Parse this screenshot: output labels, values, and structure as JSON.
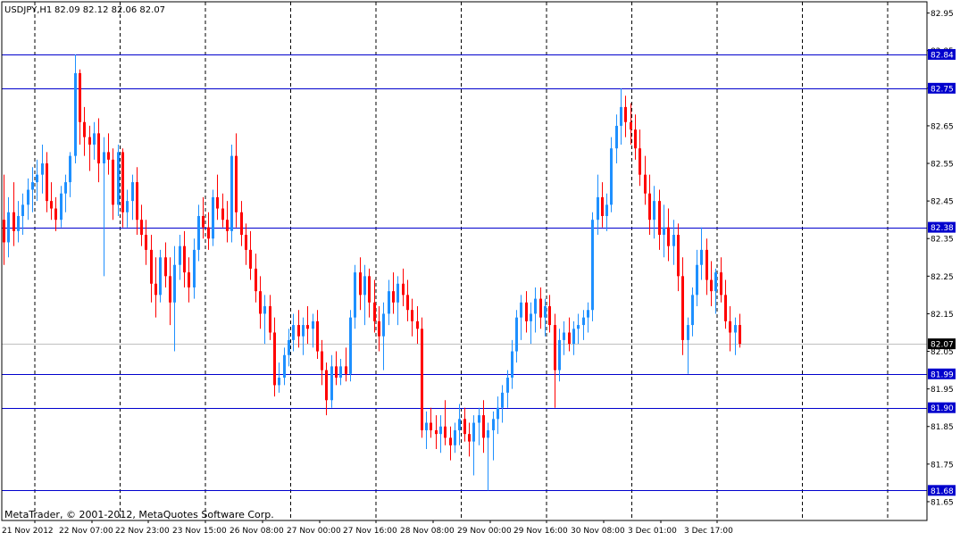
{
  "header": {
    "symbol": "USDJPY,H1",
    "ohlc": "82.09 82.12 82.06 82.07"
  },
  "footer": {
    "copyright": "MetaTrader, © 2001-2012, MetaQuotes Software Corp."
  },
  "colors": {
    "background": "#ffffff",
    "frame": "#000000",
    "bull_candle": "#1e90ff",
    "bear_candle": "#ff0000",
    "hline": "#0000cd",
    "hline_label_bg": "#0000cd",
    "hline_label_text": "#ffffff",
    "current_price_line": "#c0c0c0",
    "current_price_label_bg": "#000000",
    "current_price_label_text": "#ffffff",
    "vgrid": "#000000"
  },
  "chart_data": {
    "type": "candlestick",
    "ylim": [
      81.6,
      82.98
    ],
    "price_axis_ticks": [
      "82.95",
      "82.85",
      "82.75",
      "82.65",
      "82.55",
      "82.45",
      "82.35",
      "82.25",
      "82.15",
      "82.05",
      "81.95",
      "81.85",
      "81.75",
      "81.65"
    ],
    "time_axis_labels": [
      "21 Nov 2012",
      "22 Nov 07:00",
      "22 Nov 23:00",
      "23 Nov 15:00",
      "26 Nov 08:00",
      "27 Nov 00:00",
      "27 Nov 16:00",
      "28 Nov 08:00",
      "29 Nov 00:00",
      "29 Nov 16:00",
      "30 Nov 08:00",
      "3 Dec 01:00",
      "3 Dec 17:00"
    ],
    "vertical_separators": 15,
    "horizontal_lines": [
      {
        "label": "82.84",
        "value": 82.84
      },
      {
        "label": "82.75",
        "value": 82.75
      },
      {
        "label": "82.38",
        "value": 82.38
      },
      {
        "label": "81.99",
        "value": 81.99
      },
      {
        "label": "81.90",
        "value": 81.9
      },
      {
        "label": "81.68",
        "value": 81.68
      }
    ],
    "current_price": {
      "label": "82.07",
      "value": 82.07
    },
    "candles": [
      [
        82.4,
        82.52,
        82.28,
        82.34
      ],
      [
        82.34,
        82.46,
        82.3,
        82.42
      ],
      [
        82.42,
        82.5,
        82.33,
        82.37
      ],
      [
        82.37,
        82.45,
        82.34,
        82.41
      ],
      [
        82.41,
        82.47,
        82.36,
        82.44
      ],
      [
        82.44,
        82.51,
        82.4,
        82.48
      ],
      [
        82.48,
        82.54,
        82.42,
        82.5
      ],
      [
        82.5,
        82.56,
        82.45,
        82.52
      ],
      [
        82.52,
        82.6,
        82.47,
        82.55
      ],
      [
        82.55,
        82.58,
        82.42,
        82.45
      ],
      [
        82.45,
        82.5,
        82.4,
        82.43
      ],
      [
        82.43,
        82.46,
        82.37,
        82.4
      ],
      [
        82.4,
        82.49,
        82.38,
        82.47
      ],
      [
        82.47,
        82.52,
        82.42,
        82.5
      ],
      [
        82.5,
        82.58,
        82.46,
        82.57
      ],
      [
        82.57,
        82.84,
        82.55,
        82.79
      ],
      [
        82.79,
        82.8,
        82.6,
        82.66
      ],
      [
        82.66,
        82.7,
        82.57,
        82.62
      ],
      [
        82.62,
        82.65,
        82.53,
        82.6
      ],
      [
        82.6,
        82.66,
        82.56,
        82.63
      ],
      [
        82.63,
        82.67,
        82.5,
        82.55
      ],
      [
        82.55,
        82.62,
        82.25,
        82.58
      ],
      [
        82.58,
        82.63,
        82.52,
        82.56
      ],
      [
        82.56,
        82.59,
        82.4,
        82.44
      ],
      [
        82.44,
        82.6,
        82.41,
        82.58
      ],
      [
        82.58,
        82.59,
        82.38,
        82.42
      ],
      [
        82.42,
        82.48,
        82.38,
        82.45
      ],
      [
        82.45,
        82.52,
        82.4,
        82.5
      ],
      [
        82.5,
        82.54,
        82.36,
        82.4
      ],
      [
        82.4,
        82.44,
        82.33,
        82.36
      ],
      [
        82.36,
        82.4,
        82.28,
        82.32
      ],
      [
        82.32,
        82.36,
        82.18,
        82.23
      ],
      [
        82.23,
        82.3,
        82.14,
        82.2
      ],
      [
        82.2,
        82.32,
        82.18,
        82.3
      ],
      [
        82.3,
        82.34,
        82.22,
        82.25
      ],
      [
        82.25,
        82.3,
        82.12,
        82.18
      ],
      [
        82.18,
        82.33,
        82.05,
        82.28
      ],
      [
        82.28,
        82.36,
        82.24,
        82.33
      ],
      [
        82.33,
        82.37,
        82.22,
        82.26
      ],
      [
        82.26,
        82.3,
        82.18,
        82.22
      ],
      [
        82.22,
        82.35,
        82.19,
        82.32
      ],
      [
        82.32,
        82.44,
        82.29,
        82.41
      ],
      [
        82.41,
        82.46,
        82.35,
        82.38
      ],
      [
        82.38,
        82.42,
        82.32,
        82.35
      ],
      [
        82.35,
        82.48,
        82.33,
        82.46
      ],
      [
        82.46,
        82.52,
        82.4,
        82.43
      ],
      [
        82.43,
        82.47,
        82.38,
        82.4
      ],
      [
        82.4,
        82.45,
        82.34,
        82.37
      ],
      [
        82.37,
        82.6,
        82.34,
        82.57
      ],
      [
        82.57,
        82.63,
        82.38,
        82.42
      ],
      [
        82.42,
        82.45,
        82.33,
        82.36
      ],
      [
        82.36,
        82.39,
        82.28,
        82.32
      ],
      [
        82.32,
        82.37,
        82.24,
        82.27
      ],
      [
        82.27,
        82.31,
        82.18,
        82.21
      ],
      [
        82.21,
        82.25,
        82.11,
        82.15
      ],
      [
        82.15,
        82.2,
        82.07,
        82.17
      ],
      [
        82.17,
        82.2,
        82.08,
        82.1
      ],
      [
        82.1,
        82.14,
        81.93,
        81.96
      ],
      [
        81.96,
        82.02,
        81.94,
        81.98
      ],
      [
        81.98,
        82.06,
        81.96,
        82.04
      ],
      [
        82.04,
        82.11,
        82.01,
        82.08
      ],
      [
        82.08,
        82.15,
        82.05,
        82.12
      ],
      [
        82.12,
        82.16,
        82.06,
        82.09
      ],
      [
        82.09,
        82.14,
        82.04,
        82.12
      ],
      [
        82.12,
        82.17,
        82.07,
        82.11
      ],
      [
        82.11,
        82.15,
        82.06,
        82.13
      ],
      [
        82.13,
        82.16,
        82.03,
        82.05
      ],
      [
        82.05,
        82.08,
        81.96,
        82.0
      ],
      [
        82.0,
        82.02,
        81.88,
        81.92
      ],
      [
        81.92,
        82.04,
        81.9,
        82.01
      ],
      [
        82.01,
        82.05,
        81.96,
        81.98
      ],
      [
        81.98,
        82.03,
        81.96,
        82.01
      ],
      [
        82.01,
        82.06,
        81.97,
        81.99
      ],
      [
        81.99,
        82.16,
        81.97,
        82.14
      ],
      [
        82.14,
        82.28,
        82.11,
        82.26
      ],
      [
        82.26,
        82.3,
        82.16,
        82.2
      ],
      [
        82.2,
        82.28,
        82.12,
        82.25
      ],
      [
        82.25,
        82.27,
        82.14,
        82.18
      ],
      [
        82.18,
        82.24,
        82.1,
        82.13
      ],
      [
        82.13,
        82.17,
        82.05,
        82.09
      ],
      [
        82.09,
        82.18,
        82.0,
        82.15
      ],
      [
        82.15,
        82.24,
        82.12,
        82.21
      ],
      [
        82.21,
        82.26,
        82.15,
        82.18
      ],
      [
        82.18,
        82.25,
        82.12,
        82.23
      ],
      [
        82.23,
        82.27,
        82.17,
        82.2
      ],
      [
        82.2,
        82.24,
        82.13,
        82.16
      ],
      [
        82.16,
        82.19,
        82.09,
        82.13
      ],
      [
        82.13,
        82.17,
        82.07,
        82.11
      ],
      [
        82.11,
        82.14,
        81.82,
        81.84
      ],
      [
        81.84,
        81.89,
        81.79,
        81.86
      ],
      [
        81.86,
        81.9,
        81.82,
        81.84
      ],
      [
        81.84,
        81.88,
        81.79,
        81.83
      ],
      [
        81.83,
        81.88,
        81.78,
        81.85
      ],
      [
        81.85,
        81.92,
        81.8,
        81.82
      ],
      [
        81.82,
        81.85,
        81.76,
        81.8
      ],
      [
        81.8,
        81.86,
        81.78,
        81.84
      ],
      [
        81.84,
        81.91,
        81.8,
        81.87
      ],
      [
        81.87,
        81.9,
        81.81,
        81.83
      ],
      [
        81.83,
        81.86,
        81.77,
        81.81
      ],
      [
        81.81,
        81.88,
        81.72,
        81.86
      ],
      [
        81.86,
        81.9,
        81.8,
        81.88
      ],
      [
        81.88,
        81.92,
        81.78,
        81.82
      ],
      [
        81.82,
        81.86,
        81.68,
        81.84
      ],
      [
        81.84,
        81.89,
        81.76,
        81.87
      ],
      [
        81.87,
        81.93,
        81.83,
        81.9
      ],
      [
        81.9,
        81.96,
        81.86,
        81.94
      ],
      [
        81.94,
        82.0,
        81.9,
        81.98
      ],
      [
        81.98,
        82.08,
        81.95,
        82.05
      ],
      [
        82.05,
        82.16,
        82.02,
        82.14
      ],
      [
        82.14,
        82.2,
        82.08,
        82.18
      ],
      [
        82.18,
        82.21,
        82.1,
        82.13
      ],
      [
        82.13,
        82.18,
        82.07,
        82.15
      ],
      [
        82.15,
        82.22,
        82.1,
        82.19
      ],
      [
        82.19,
        82.22,
        82.11,
        82.14
      ],
      [
        82.14,
        82.19,
        82.09,
        82.17
      ],
      [
        82.17,
        82.2,
        82.1,
        82.12
      ],
      [
        82.12,
        82.15,
        81.9,
        82.0
      ],
      [
        82.0,
        82.11,
        81.97,
        82.08
      ],
      [
        82.08,
        82.13,
        82.04,
        82.1
      ],
      [
        82.1,
        82.14,
        82.05,
        82.07
      ],
      [
        82.07,
        82.13,
        82.04,
        82.11
      ],
      [
        82.11,
        82.15,
        82.07,
        82.12
      ],
      [
        82.12,
        82.16,
        82.08,
        82.14
      ],
      [
        82.14,
        82.18,
        82.1,
        82.16
      ],
      [
        82.16,
        82.42,
        82.13,
        82.4
      ],
      [
        82.4,
        82.52,
        82.36,
        82.46
      ],
      [
        82.46,
        82.5,
        82.38,
        82.41
      ],
      [
        82.41,
        82.47,
        82.37,
        82.44
      ],
      [
        82.44,
        82.62,
        82.42,
        82.59
      ],
      [
        82.59,
        82.68,
        82.55,
        82.65
      ],
      [
        82.65,
        82.75,
        82.6,
        82.7
      ],
      [
        82.7,
        82.73,
        82.62,
        82.66
      ],
      [
        82.66,
        82.71,
        82.6,
        82.64
      ],
      [
        82.64,
        82.68,
        82.56,
        82.59
      ],
      [
        82.59,
        82.64,
        82.49,
        82.52
      ],
      [
        82.52,
        82.57,
        82.44,
        82.47
      ],
      [
        82.47,
        82.52,
        82.36,
        82.4
      ],
      [
        82.4,
        82.49,
        82.35,
        82.45
      ],
      [
        82.45,
        82.48,
        82.32,
        82.36
      ],
      [
        82.36,
        82.44,
        82.3,
        82.38
      ],
      [
        82.38,
        82.43,
        82.29,
        82.33
      ],
      [
        82.33,
        82.4,
        82.28,
        82.36
      ],
      [
        82.36,
        82.39,
        82.21,
        82.25
      ],
      [
        82.25,
        82.3,
        82.04,
        82.08
      ],
      [
        82.08,
        82.14,
        81.99,
        82.12
      ],
      [
        82.12,
        82.22,
        82.09,
        82.2
      ],
      [
        82.2,
        82.32,
        82.17,
        82.28
      ],
      [
        82.28,
        82.38,
        82.24,
        82.32
      ],
      [
        82.32,
        82.35,
        82.2,
        82.24
      ],
      [
        82.24,
        82.29,
        82.17,
        82.21
      ],
      [
        82.21,
        82.27,
        82.15,
        82.26
      ],
      [
        82.26,
        82.3,
        82.18,
        82.2
      ],
      [
        82.2,
        82.24,
        82.11,
        82.13
      ],
      [
        82.13,
        82.17,
        82.05,
        82.1
      ],
      [
        82.1,
        82.14,
        82.04,
        82.12
      ],
      [
        82.12,
        82.15,
        82.06,
        82.07
      ]
    ]
  }
}
